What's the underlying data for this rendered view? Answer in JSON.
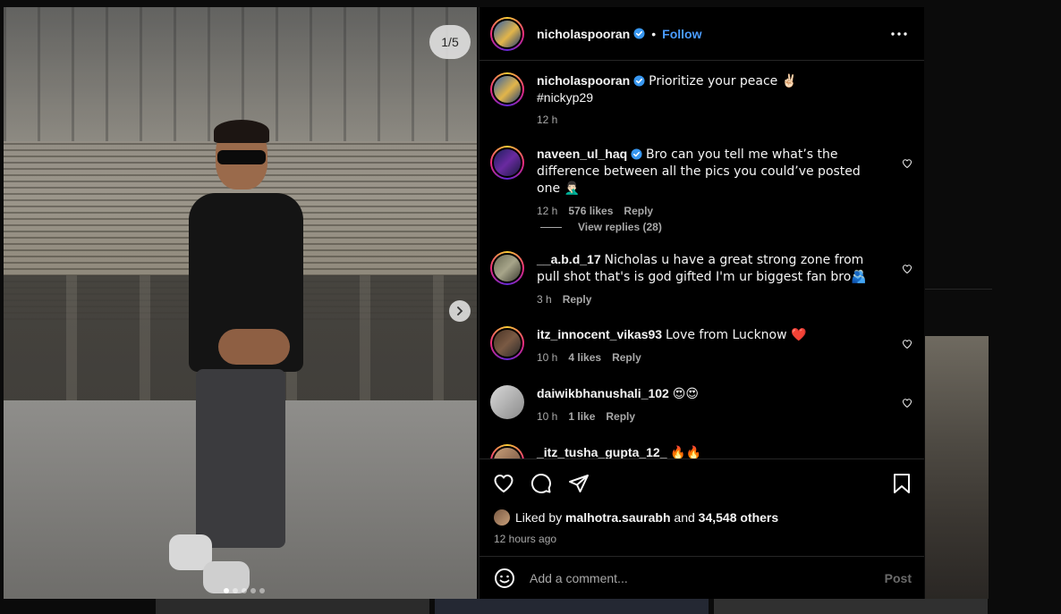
{
  "media": {
    "counter": "1/5",
    "dot_count": 5,
    "active_dot": 0
  },
  "header": {
    "username": "nicholaspooran",
    "separator": "•",
    "follow_label": "Follow"
  },
  "caption": {
    "username": "nicholaspooran",
    "text": "Prioritize your peace ✌🏻",
    "hashtag": "#nickyp29",
    "time": "12 h"
  },
  "comments": [
    {
      "username": "naveen_ul_haq",
      "verified": true,
      "text": "Bro can you tell me what’s the difference between all the pics you could’ve posted one 🤦🏻‍♂️",
      "time": "12 h",
      "likes": "576 likes",
      "reply_label": "Reply"
    },
    {
      "username": "__a.b.d_17",
      "verified": false,
      "text": "Nicholas u have a great strong zone from pull shot that's is god gifted I'm ur biggest fan bro🫂",
      "time": "3 h",
      "likes": "",
      "reply_label": "Reply"
    },
    {
      "username": "itz_innocent_vikas93",
      "verified": false,
      "text": "Love from Lucknow ❤️",
      "time": "10 h",
      "likes": "4 likes",
      "reply_label": "Reply"
    },
    {
      "username": "daiwikbhanushali_102",
      "verified": false,
      "text": "😍😍",
      "time": "10 h",
      "likes": "1 like",
      "reply_label": "Reply"
    },
    {
      "username": "_itz_tusha_gupta_12_",
      "verified": false,
      "text": "🔥🔥",
      "time": "",
      "likes": "",
      "reply_label": ""
    }
  ],
  "view_replies": "View replies (28)",
  "likes": {
    "prefix": "Liked by",
    "user": "malhotra.saurabh",
    "joiner": "and",
    "others": "34,548 others"
  },
  "time_ago": "12 hours ago",
  "add_comment": {
    "placeholder": "Add a comment...",
    "post_label": "Post"
  },
  "colors": {
    "accent": "#4a9cff",
    "verified": "#3897f0",
    "muted": "#a8a8a8",
    "background": "#000000"
  }
}
